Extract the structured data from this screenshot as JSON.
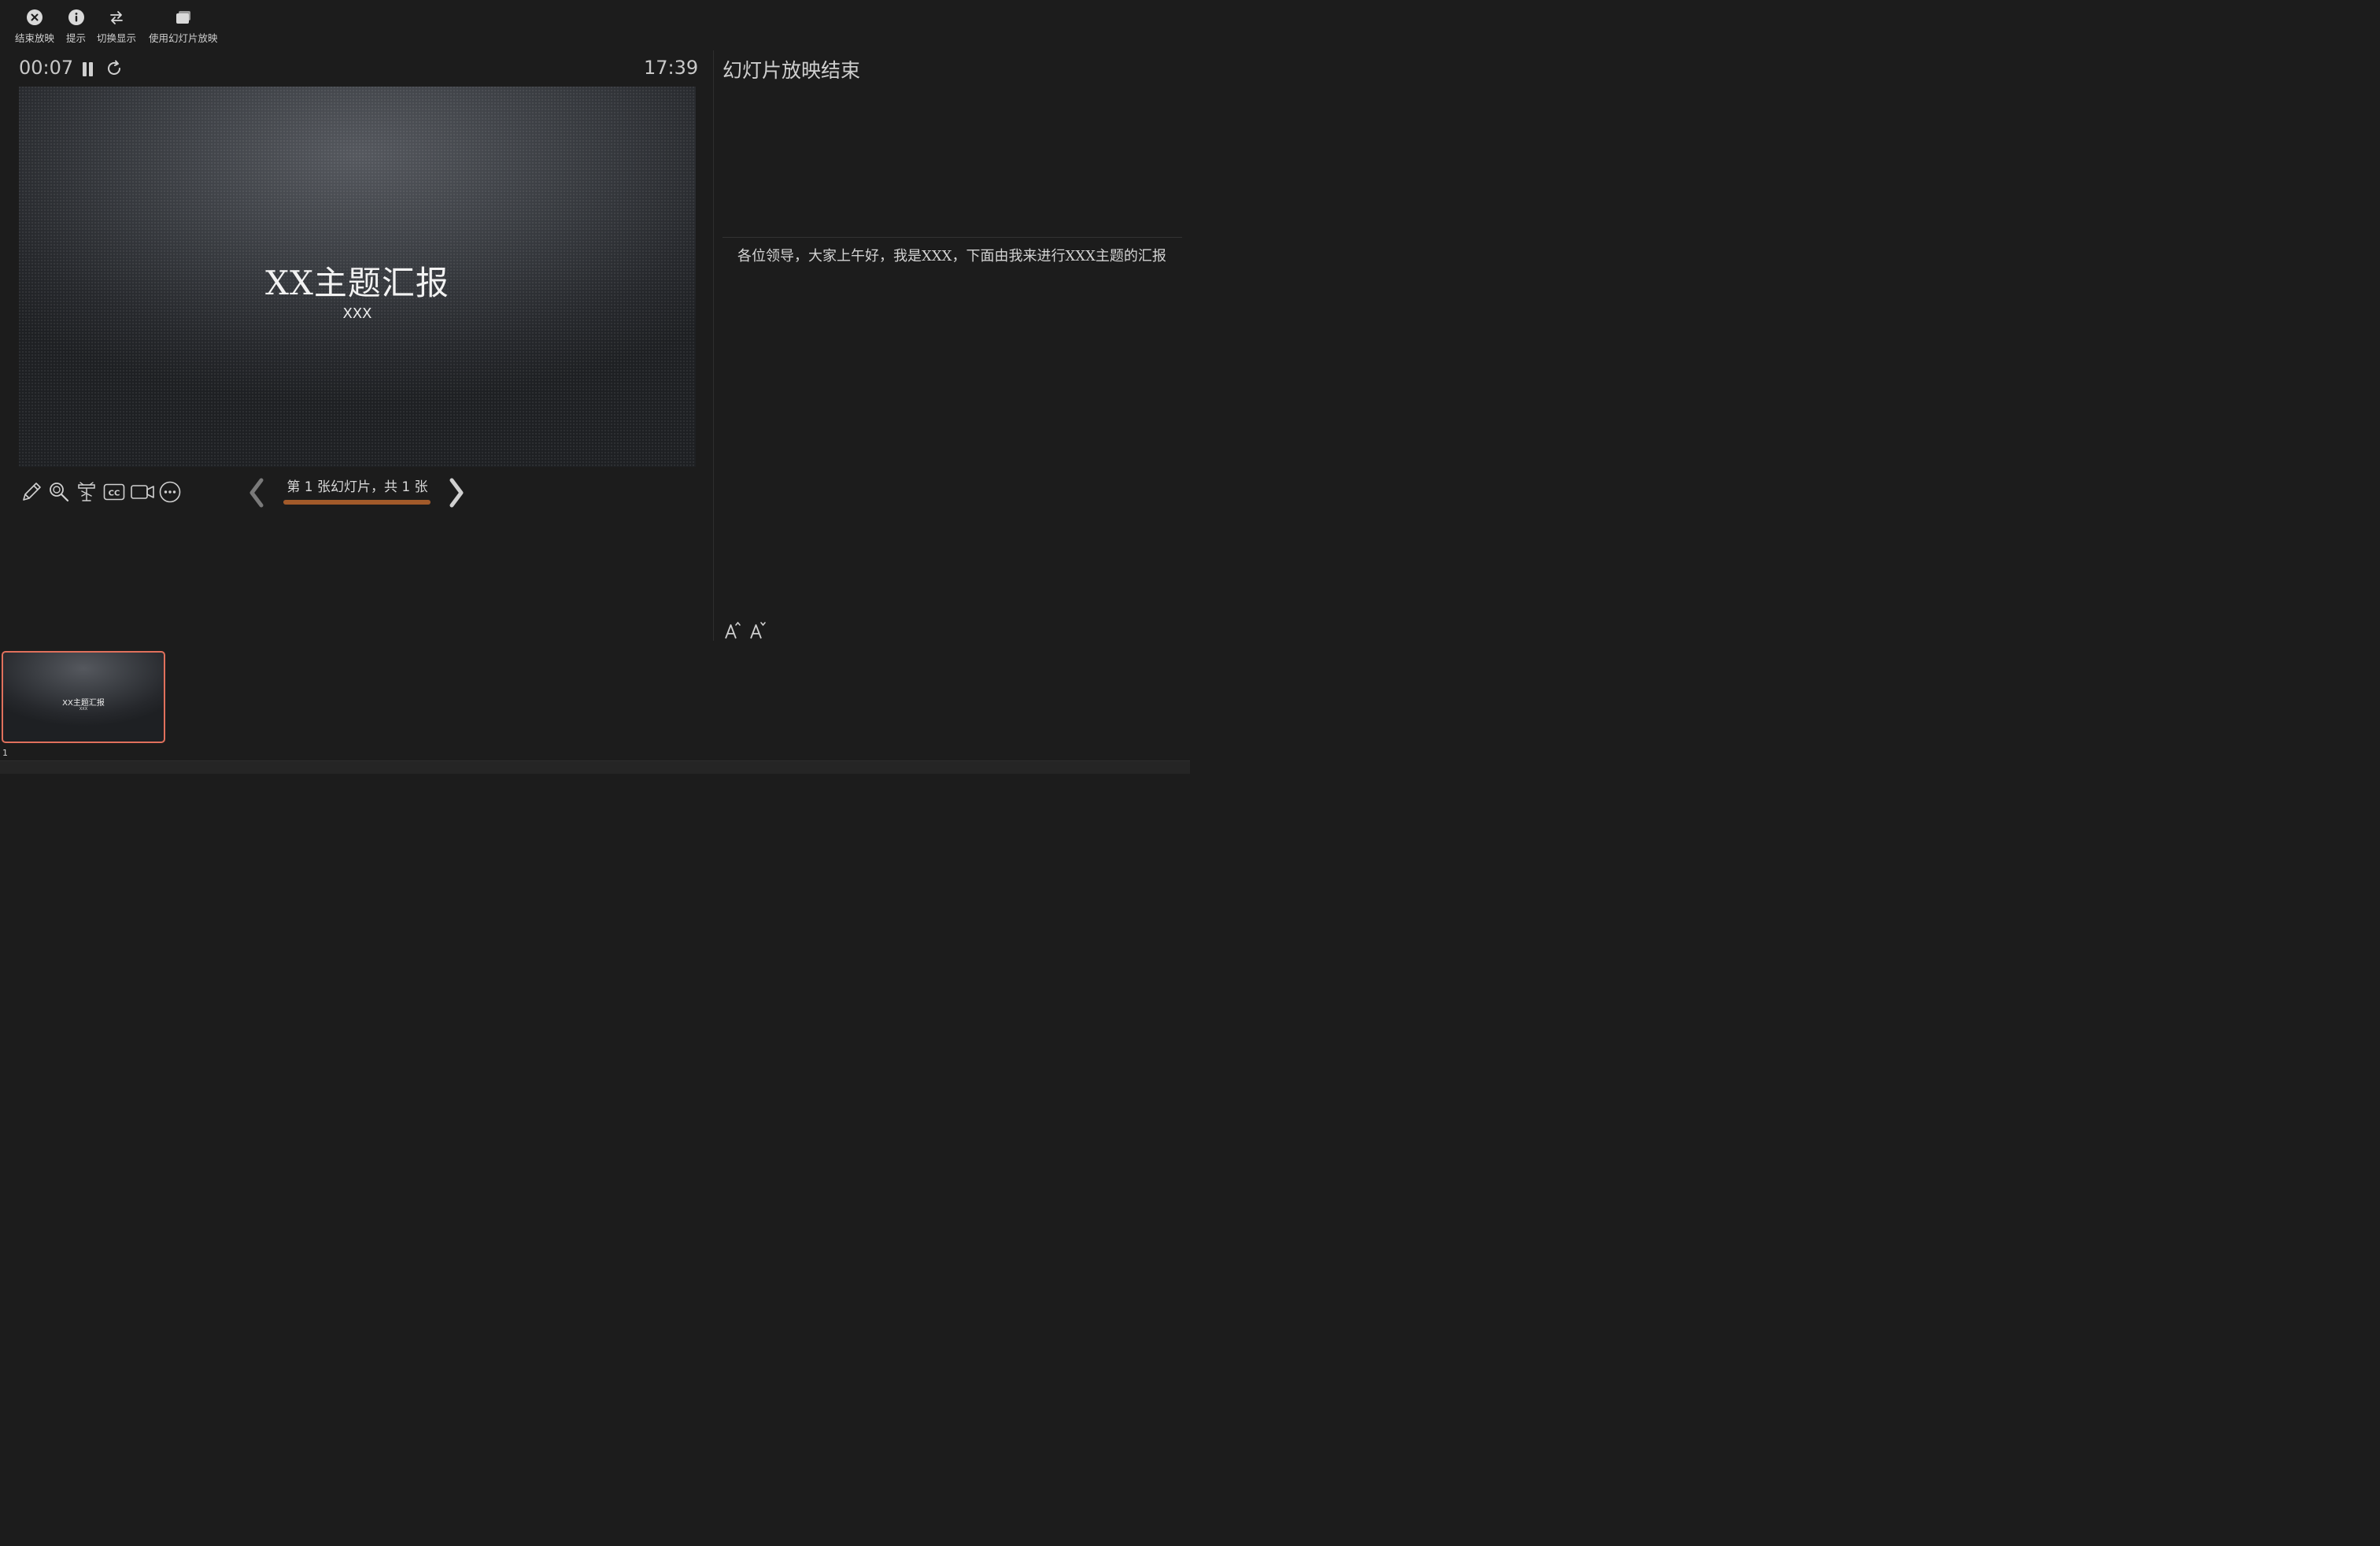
{
  "toolbar": {
    "end_show": "结束放映",
    "hints": "提示",
    "swap_displays": "切换显示",
    "use_slideshow": "使用幻灯片放映"
  },
  "presenter": {
    "elapsed": "00:07",
    "clock": "17:39"
  },
  "slide": {
    "title": "XX主题汇报",
    "subtitle": "XXX"
  },
  "navigation": {
    "slide_count": "第 1 张幻灯片，共 1 张",
    "progress": 1.0
  },
  "next_slide": {
    "label": "幻灯片放映结束"
  },
  "notes": {
    "text": "各位领导，大家上午好，我是XXX，下面由我来进行XXX主题的汇报"
  },
  "thumbnails": [
    {
      "number": "1",
      "title": "XX主题汇报",
      "subtitle": "XXX"
    }
  ],
  "colors": {
    "progress_accent": "#a25a2a",
    "selection_border": "#e0705c",
    "background": "#1c1c1c"
  }
}
